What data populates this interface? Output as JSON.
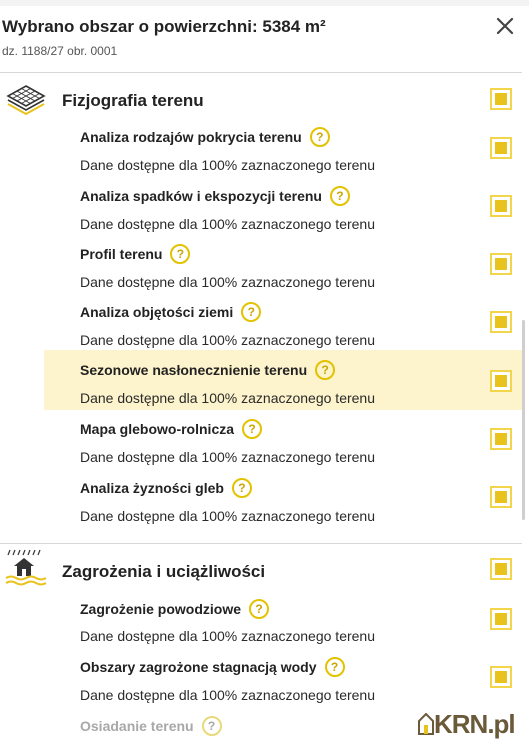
{
  "header": {
    "title": "Wybrano obszar o powierzchni: 5384 m²",
    "subtitle": "dz. 1188/27 obr. 0001",
    "close_icon": "close-icon"
  },
  "sections": [
    {
      "title": "Fizjografia terenu",
      "icon": "terrain-grid-icon",
      "items": [
        {
          "title": "Analiza rodzajów pokrycia terenu",
          "desc": "Dane dostępne dla 100% zaznaczonego terenu"
        },
        {
          "title": "Analiza spadków i ekspozycji terenu",
          "desc": "Dane dostępne dla 100% zaznaczonego terenu"
        },
        {
          "title": "Profil terenu",
          "desc": "Dane dostępne dla 100% zaznaczonego terenu"
        },
        {
          "title": "Analiza objętości ziemi",
          "desc": "Dane dostępne dla 100% zaznaczonego terenu"
        },
        {
          "title": "Sezonowe nasłonecznienie terenu",
          "desc": "Dane dostępne dla 100% zaznaczonego terenu"
        },
        {
          "title": "Mapa glebowo-rolnicza",
          "desc": "Dane dostępne dla 100% zaznaczonego terenu"
        },
        {
          "title": "Analiza żyzności gleb",
          "desc": "Dane dostępne dla 100% zaznaczonego terenu"
        }
      ]
    },
    {
      "title": "Zagrożenia i uciążliwości",
      "icon": "flood-house-icon",
      "items": [
        {
          "title": "Zagrożenie powodziowe",
          "desc": "Dane dostępne dla 100% zaznaczonego terenu"
        },
        {
          "title": "Obszary zagrożone stagnacją wody",
          "desc": "Dane dostępne dla 100% zaznaczonego terenu"
        },
        {
          "title": "Osiadanie terenu",
          "desc": ""
        }
      ]
    }
  ],
  "help_glyph": "?",
  "watermark": "KRN.pl",
  "colors": {
    "accent": "#e8c21d",
    "highlight": "#fdf3cc"
  }
}
